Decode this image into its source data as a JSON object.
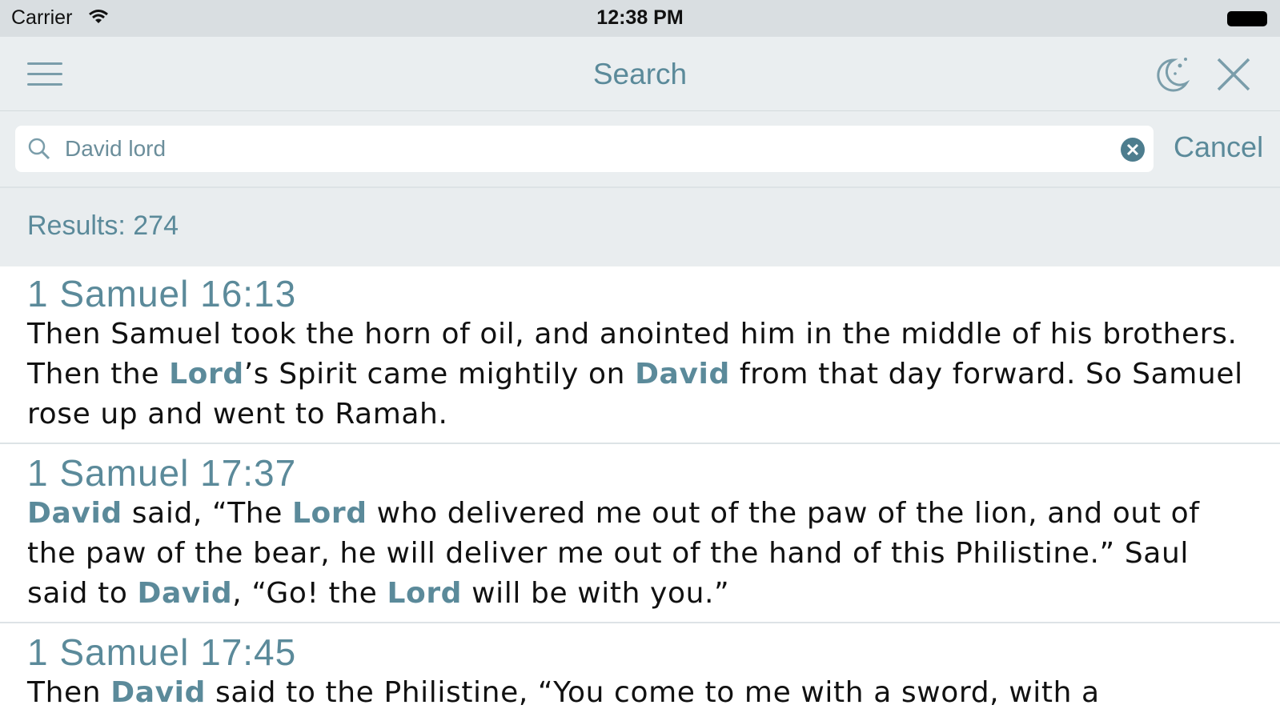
{
  "status_bar": {
    "carrier": "Carrier",
    "time": "12:38 PM"
  },
  "nav": {
    "title": "Search",
    "menu_icon": "hamburger-menu-icon",
    "night_icon": "night-mode-icon",
    "close_icon": "close-icon"
  },
  "search": {
    "query": "David lord",
    "cancel_label": "Cancel"
  },
  "results": {
    "label": "Results: 274",
    "items": [
      {
        "reference": "1 Samuel 16:13",
        "segments": [
          {
            "t": "Then Samuel took the horn of oil, and anointed him in the middle of his brothers. Then the ",
            "h": false
          },
          {
            "t": "Lord",
            "h": true
          },
          {
            "t": "’s Spirit came mightily on ",
            "h": false
          },
          {
            "t": "David",
            "h": true
          },
          {
            "t": " from that day forward. So Samuel rose up and went to Ramah.",
            "h": false
          }
        ]
      },
      {
        "reference": "1 Samuel 17:37",
        "segments": [
          {
            "t": "David",
            "h": true
          },
          {
            "t": " said, “The ",
            "h": false
          },
          {
            "t": "Lord",
            "h": true
          },
          {
            "t": " who delivered me out of the paw of the lion, and out of the paw of the bear, he will deliver me out of the hand of this Philistine.” Saul said to ",
            "h": false
          },
          {
            "t": "David",
            "h": true
          },
          {
            "t": ", “Go! the ",
            "h": false
          },
          {
            "t": "Lord",
            "h": true
          },
          {
            "t": " will be with you.”",
            "h": false
          }
        ]
      },
      {
        "reference": "1 Samuel 17:45",
        "segments": [
          {
            "t": "Then ",
            "h": false
          },
          {
            "t": "David",
            "h": true
          },
          {
            "t": " said to the Philistine, “You come to me with a sword, with a",
            "h": false
          }
        ]
      }
    ]
  },
  "colors": {
    "accent": "#5b8a9a",
    "bar_background": "#eaeef0"
  }
}
